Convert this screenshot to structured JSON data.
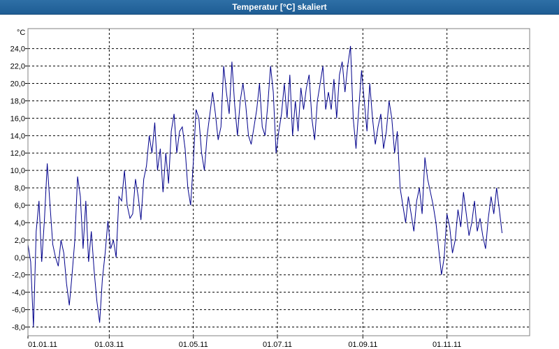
{
  "window": {
    "title": "Temperatur [°C] skaliert"
  },
  "colors": {
    "titlebar": "#1e5d94",
    "series": "#00008b",
    "grid": "#000000"
  },
  "chart_data": {
    "type": "line",
    "title": "Temperatur [°C] skaliert",
    "ylabel": "°C",
    "xlabel": "",
    "ylim": [
      -9.0,
      26.3
    ],
    "yticks": [
      -8.0,
      -6.0,
      -4.0,
      -2.0,
      0.0,
      2.0,
      4.0,
      6.0,
      8.0,
      10.0,
      12.0,
      14.0,
      16.0,
      18.0,
      20.0,
      22.0,
      24.0
    ],
    "ytick_labels": [
      "-8,0",
      "-6,0",
      "-4,0",
      "-2,0",
      "0,0",
      "2,0",
      "4,0",
      "6,0",
      "8,0",
      "10,0",
      "12,0",
      "14,0",
      "16,0",
      "18,0",
      "20,0",
      "22,0",
      "24,0"
    ],
    "xlim_days": [
      0,
      364
    ],
    "xticks_days": [
      0,
      59,
      120,
      181,
      243,
      304
    ],
    "xtick_labels": [
      "01.01.11",
      "01.03.11",
      "01.05.11",
      "01.07.11",
      "01.09.11",
      "01.11.11"
    ],
    "grid": true,
    "series": [
      {
        "color": "#00008b",
        "x_days": [
          0,
          2,
          4,
          6,
          8,
          10,
          12,
          14,
          16,
          18,
          20,
          22,
          24,
          26,
          28,
          30,
          32,
          34,
          36,
          38,
          40,
          42,
          44,
          46,
          48,
          50,
          52,
          54,
          56,
          58,
          60,
          62,
          64,
          66,
          68,
          70,
          72,
          74,
          76,
          78,
          80,
          82,
          84,
          86,
          88,
          90,
          92,
          94,
          96,
          98,
          100,
          102,
          104,
          106,
          108,
          110,
          112,
          114,
          116,
          118,
          120,
          122,
          124,
          126,
          128,
          130,
          132,
          134,
          136,
          138,
          140,
          142,
          144,
          146,
          148,
          150,
          152,
          154,
          156,
          158,
          160,
          162,
          164,
          166,
          168,
          170,
          172,
          174,
          176,
          178,
          180,
          182,
          184,
          186,
          188,
          190,
          192,
          194,
          196,
          198,
          200,
          202,
          204,
          206,
          208,
          210,
          212,
          214,
          216,
          218,
          220,
          222,
          224,
          226,
          228,
          230,
          232,
          234,
          236,
          238,
          240,
          242,
          244,
          246,
          248,
          250,
          252,
          254,
          256,
          258,
          260,
          262,
          264,
          266,
          268,
          270,
          272,
          274,
          276,
          278,
          280,
          282,
          284,
          286,
          288,
          290,
          292,
          294,
          296,
          298,
          300,
          302,
          304,
          306,
          308,
          310,
          312,
          314,
          316,
          318,
          320,
          322,
          324,
          326,
          328,
          330,
          332,
          334,
          336,
          338,
          340,
          342,
          344,
          346,
          348,
          350,
          352,
          354,
          356,
          358,
          360,
          362,
          364
        ],
        "values": [
          1.5,
          -0.5,
          -8.0,
          3.0,
          6.5,
          -0.5,
          4.5,
          10.8,
          6.0,
          1.5,
          0.0,
          -1.0,
          2.0,
          0.5,
          -3.0,
          -5.5,
          -2.0,
          2.0,
          9.3,
          7.0,
          1.0,
          6.5,
          -0.5,
          3.0,
          -1.5,
          -5.0,
          -7.5,
          -2.5,
          0.5,
          4.2,
          1.0,
          2.0,
          0.0,
          7.0,
          6.5,
          10.0,
          6.0,
          4.5,
          5.0,
          9.0,
          7.0,
          4.3,
          9.0,
          10.5,
          14.0,
          12.0,
          15.5,
          10.0,
          12.5,
          7.5,
          12.0,
          8.5,
          14.5,
          16.5,
          12.0,
          14.5,
          15.0,
          12.5,
          8.0,
          6.0,
          11.0,
          17.0,
          16.0,
          12.0,
          10.0,
          14.0,
          16.5,
          19.0,
          16.5,
          13.5,
          15.0,
          22.0,
          19.0,
          16.5,
          22.5,
          17.5,
          14.0,
          18.0,
          20.0,
          17.5,
          14.0,
          13.0,
          15.0,
          17.0,
          20.0,
          15.0,
          14.0,
          17.5,
          22.0,
          19.0,
          12.0,
          14.5,
          16.5,
          20.0,
          16.0,
          21.0,
          14.0,
          18.0,
          14.5,
          19.5,
          17.0,
          19.5,
          21.0,
          16.0,
          13.5,
          18.0,
          20.0,
          22.0,
          17.0,
          19.0,
          17.0,
          20.5,
          16.0,
          21.0,
          22.5,
          19.0,
          22.0,
          24.3,
          16.0,
          12.5,
          17.0,
          21.5,
          18.0,
          14.5,
          20.0,
          16.0,
          13.0,
          15.0,
          16.5,
          12.5,
          14.5,
          18.0,
          16.0,
          12.0,
          14.5,
          8.0,
          6.0,
          4.0,
          7.0,
          5.0,
          3.0,
          6.5,
          8.0,
          5.0,
          11.5,
          9.0,
          7.5,
          6.0,
          4.0,
          1.0,
          -2.0,
          0.0,
          5.0,
          3.5,
          0.5,
          2.0,
          5.5,
          3.5,
          7.5,
          5.0,
          2.5,
          4.0,
          6.5,
          3.0,
          4.5,
          2.5,
          1.0,
          4.5,
          7.0,
          5.0,
          8.0,
          5.5,
          2.8
        ]
      }
    ]
  }
}
